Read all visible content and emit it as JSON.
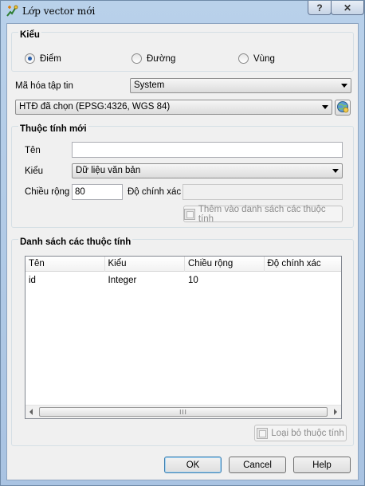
{
  "window": {
    "title": "Lớp vector mới",
    "help_label": "?",
    "close_label": "✕"
  },
  "type_group": {
    "title": "Kiểu",
    "options": [
      {
        "label": "Điểm",
        "selected": true
      },
      {
        "label": "Đường",
        "selected": false
      },
      {
        "label": "Vùng",
        "selected": false
      }
    ]
  },
  "encoding": {
    "label": "Mã hóa tập tin",
    "value": "System"
  },
  "crs": {
    "value": "HTĐ đã chọn (EPSG:4326, WGS 84)",
    "icon": "globe-icon"
  },
  "new_attribute": {
    "title": "Thuộc tính mới",
    "name_label": "Tên",
    "name_value": "",
    "type_label": "Kiểu",
    "type_value": "Dữ liệu văn bản",
    "width_label": "Chiều rộng",
    "width_value": "80",
    "precision_label": "Độ chính xác",
    "precision_value": "",
    "add_button": "Thêm vào danh sách các thuộc tính"
  },
  "attribute_list": {
    "title": "Danh sách các thuộc tính",
    "columns": [
      "Tên",
      "Kiểu",
      "Chiều rộng",
      "Độ chính xác"
    ],
    "rows": [
      [
        "id",
        "Integer",
        "10",
        ""
      ]
    ],
    "scroll_grip": "III",
    "remove_button": "Loại bỏ thuộc tính"
  },
  "buttons": {
    "ok": "OK",
    "cancel": "Cancel",
    "help": "Help"
  },
  "colors": {
    "accent": "#2a5ea8",
    "title_bar": "#b9d1ea"
  }
}
